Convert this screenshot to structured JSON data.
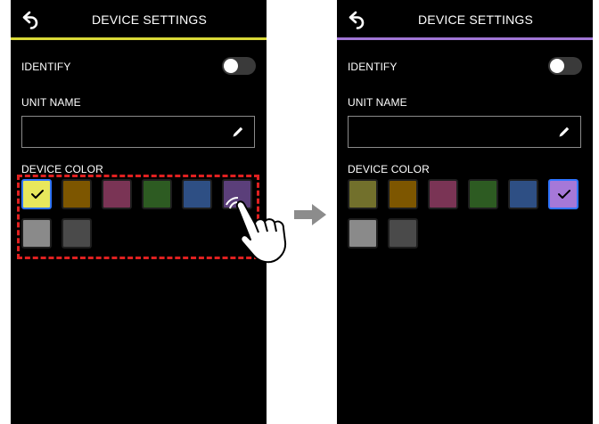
{
  "left_screen": {
    "title": "DEVICE SETTINGS",
    "identify_label": "IDENTIFY",
    "unit_name_label": "UNIT NAME",
    "unit_name_value": "",
    "device_color_label": "DEVICE COLOR",
    "accent_color": "#d9d937",
    "identify_on": false,
    "selected_color": "yellow",
    "colors": [
      {
        "name": "yellow",
        "hex": "#e8e85c"
      },
      {
        "name": "brown",
        "hex": "#7d5600"
      },
      {
        "name": "maroon",
        "hex": "#7a3455"
      },
      {
        "name": "green",
        "hex": "#2d5b22"
      },
      {
        "name": "blue",
        "hex": "#2e4f84"
      },
      {
        "name": "purple",
        "hex": "#5b3f7a"
      },
      {
        "name": "light-gray",
        "hex": "#8a8a8a"
      },
      {
        "name": "dark-gray",
        "hex": "#4a4a4a"
      }
    ]
  },
  "right_screen": {
    "title": "DEVICE SETTINGS",
    "identify_label": "IDENTIFY",
    "unit_name_label": "UNIT NAME",
    "unit_name_value": "",
    "device_color_label": "DEVICE COLOR",
    "accent_color": "#a176d6",
    "identify_on": false,
    "selected_color": "purple",
    "colors": [
      {
        "name": "olive",
        "hex": "#72702c"
      },
      {
        "name": "brown",
        "hex": "#7d5600"
      },
      {
        "name": "maroon",
        "hex": "#7a3455"
      },
      {
        "name": "green",
        "hex": "#2d5b22"
      },
      {
        "name": "blue",
        "hex": "#2e4f84"
      },
      {
        "name": "purple",
        "hex": "#a678d8"
      },
      {
        "name": "light-gray",
        "hex": "#8a8a8a"
      },
      {
        "name": "dark-gray",
        "hex": "#4a4a4a"
      }
    ]
  },
  "icons": {
    "back": "back-arrow-icon",
    "edit": "pencil-icon",
    "check": "checkmark-icon",
    "tap": "tapping-hand-icon",
    "transition": "right-arrow-icon"
  },
  "annotation": {
    "highlight_color": "#e02020",
    "arrow_color": "#8c8c8c"
  }
}
